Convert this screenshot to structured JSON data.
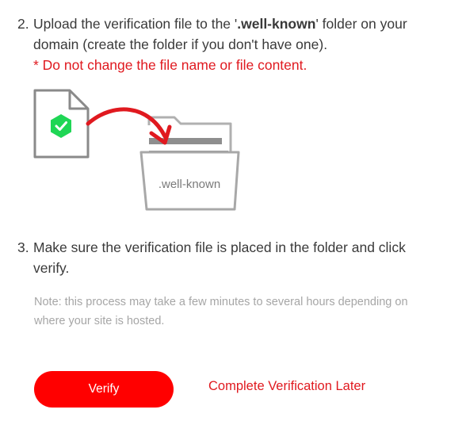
{
  "step2": {
    "number": "2.",
    "text_before": "Upload the verification file to the '",
    "highlight": ".well-known",
    "text_after_line1": "' folder on your",
    "line2": "domain (create the folder if you don't have one).",
    "warning": "* Do not change the file name or file content."
  },
  "illustration": {
    "folder_label": ".well-known",
    "colors": {
      "file_outline": "#8a8a8a",
      "check_badge": "#1fd655",
      "arrow": "#e0191f",
      "folder_outline": "#a8a8a8"
    }
  },
  "step3": {
    "number": "3.",
    "line1": "Make sure the verification file is placed in the folder and click",
    "line2": "verify."
  },
  "note": {
    "line1": "Note: this process may take a few minutes to several hours depending on",
    "line2": "where your site is hosted."
  },
  "actions": {
    "verify_label": "Verify",
    "later_label": "Complete Verification Later"
  },
  "colors": {
    "accent": "#ff0000",
    "warning": "#e0191f",
    "muted": "#a6a6a6"
  }
}
